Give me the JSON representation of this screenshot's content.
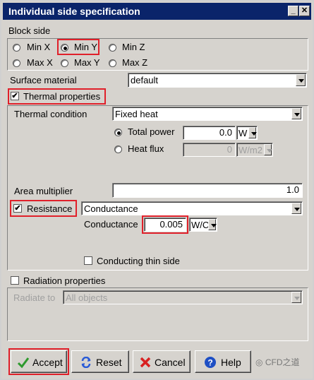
{
  "window": {
    "title": "Individual side specification"
  },
  "block_side": {
    "label": "Block side",
    "options": [
      {
        "label": "Min X",
        "selected": false
      },
      {
        "label": "Min Y",
        "selected": true
      },
      {
        "label": "Min Z",
        "selected": false
      },
      {
        "label": "Max X",
        "selected": false
      },
      {
        "label": "Max Y",
        "selected": false
      },
      {
        "label": "Max Z",
        "selected": false
      }
    ]
  },
  "surface_material": {
    "label": "Surface material",
    "value": "default"
  },
  "thermal_properties": {
    "label": "Thermal properties",
    "checked": true
  },
  "thermal_condition": {
    "label": "Thermal condition",
    "value": "Fixed heat"
  },
  "total_power": {
    "label": "Total power",
    "value": "0.0",
    "unit": "W",
    "selected": true
  },
  "heat_flux": {
    "label": "Heat flux",
    "value": "0",
    "unit": "W/m2",
    "selected": false
  },
  "area_multiplier": {
    "label": "Area multiplier",
    "value": "1.0"
  },
  "resistance": {
    "label": "Resistance",
    "checked": true,
    "type": "Conductance"
  },
  "conductance": {
    "label": "Conductance",
    "value": "0.005",
    "unit": "W/C"
  },
  "conducting_thin_side": {
    "label": "Conducting thin side",
    "checked": false
  },
  "radiation_properties": {
    "label": "Radiation properties",
    "checked": false
  },
  "radiate_to": {
    "label": "Radiate to",
    "value": "All objects"
  },
  "buttons": {
    "accept": "Accept",
    "reset": "Reset",
    "cancel": "Cancel",
    "help": "Help"
  },
  "watermark": "CFD之道",
  "colors": {
    "highlight": "#e0202a",
    "titlebar": "#0a246a"
  }
}
